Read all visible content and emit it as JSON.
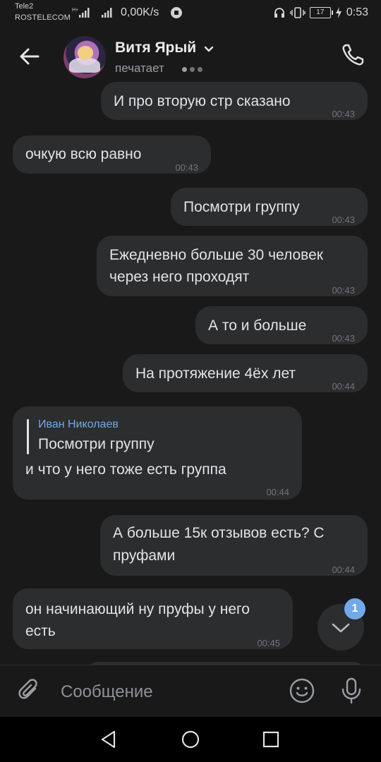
{
  "status_bar": {
    "carrier_1": "Tele2",
    "carrier_2": "ROSTELECOM",
    "net_speed": "0,00K/s",
    "battery": "17",
    "time": "0:53"
  },
  "header": {
    "contact_name": "Витя Ярый",
    "status": "печатает"
  },
  "messages": [
    {
      "side": "out",
      "text": "И про вторую стр сказано",
      "time": "00:43"
    },
    {
      "side": "in",
      "text": "очкую всю равно",
      "time": "00:43"
    },
    {
      "side": "out",
      "text": "Посмотри группу",
      "time": "00:43"
    },
    {
      "side": "out",
      "text_line1": "Ежедневно больше 30 человек",
      "text_line2": "через него проходят",
      "time": "00:43"
    },
    {
      "side": "out",
      "text": "А то и больше",
      "time": "00:43"
    },
    {
      "side": "out",
      "text": "На протяжение 4ёх лет",
      "time": "00:44"
    },
    {
      "side": "in",
      "reply_author": "Иван Николаев",
      "reply_text": "Посмотри группу",
      "text": "и что у него тоже есть группа",
      "time": "00:44"
    },
    {
      "side": "out",
      "text_line1": "А больше 15к отзывов есть? С",
      "text_line2": "пруфами",
      "time": "00:44"
    },
    {
      "side": "in",
      "text_line1": "он начинающий ну пруфы у него",
      "text_line2": "есть",
      "time": "00:45"
    }
  ],
  "scroll": {
    "unread_count": "1"
  },
  "composer": {
    "placeholder": "Сообщение"
  },
  "colors": {
    "background": "#19191a",
    "bubble": "#2c2d2e",
    "accent": "#71aaeb",
    "time": "#707478"
  },
  "icons": [
    "back-arrow-icon",
    "chevron-down-icon",
    "phone-icon",
    "scroll-down-icon",
    "paperclip-icon",
    "emoji-icon",
    "microphone-icon",
    "nav-back-icon",
    "nav-home-icon",
    "nav-recent-icon"
  ]
}
